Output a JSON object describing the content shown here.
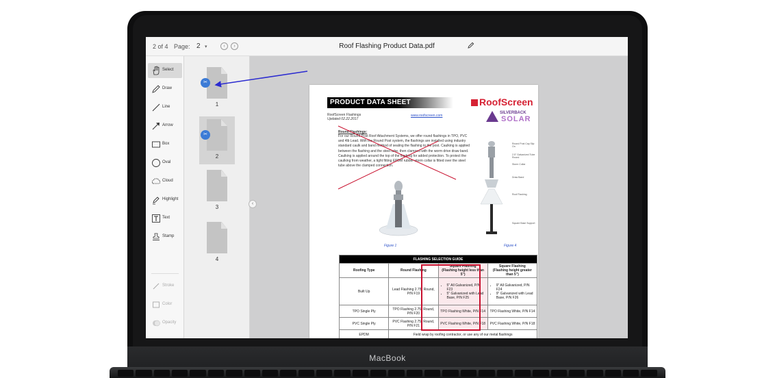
{
  "laptop": {
    "brand": "MacBook"
  },
  "topbar": {
    "page_count": "2 of 4",
    "page_label": "Page:",
    "page_value": "2",
    "caret": "▾",
    "prev": "‹",
    "next": "›",
    "title": "Roof Flashing Product Data.pdf"
  },
  "tools": [
    {
      "label": "Select",
      "icon": "hand-icon"
    },
    {
      "label": "Draw",
      "icon": "pencil-icon"
    },
    {
      "label": "Line",
      "icon": "line-icon"
    },
    {
      "label": "Arrow",
      "icon": "arrow-icon"
    },
    {
      "label": "Box",
      "icon": "box-icon"
    },
    {
      "label": "Oval",
      "icon": "oval-icon"
    },
    {
      "label": "Cloud",
      "icon": "cloud-icon"
    },
    {
      "label": "Highlight",
      "icon": "highlighter-icon"
    },
    {
      "label": "Text",
      "icon": "text-icon"
    },
    {
      "label": "Stamp",
      "icon": "stamp-icon"
    },
    {
      "label": "Stroke",
      "icon": "stroke-icon"
    },
    {
      "label": "Color",
      "icon": "color-icon"
    },
    {
      "label": "Opacity",
      "icon": "opacity-icon"
    }
  ],
  "thumbnails": [
    {
      "num": "1",
      "badge": "✂",
      "selected": false
    },
    {
      "num": "2",
      "badge": "✂",
      "selected": true
    },
    {
      "num": "3",
      "selected": false
    },
    {
      "num": "4",
      "selected": false
    }
  ],
  "collapse_glyph": "‹",
  "document": {
    "header": "PRODUCT DATA SHEET",
    "logo": "RoofScreen",
    "solar_top": "SILVERBACK",
    "solar_bottom": "SOLAR",
    "subtitle": "RoofScreen Flashings",
    "updated": "Updated 02.22.2017",
    "link": "www.roofscreen.com",
    "section_title": "Round Flashings:",
    "body": "For our Round Post Roof Attachment Systems, we offer round flashings in TPO, PVC and 4lb Lead. With the Round Post system, the flashings are installed using industry standard caulk and band method of sealing the flashing to the post. Caulking is applied between the flashing and the steel tube, then clamped with the worm drive draw band. Caulking is applied around the top of the flashing for added protection. To protect the caulking from weather, a tight fitting EPDM rubber storm collar is fitted over the steel tube above the clamped connection.",
    "fig1": "Figure 1",
    "fig4": "Figure 4",
    "callouts": [
      "Round Post Cap Slip On",
      "2.5\" Galvanized Tube Round",
      "Storm Collar",
      "Draw Band",
      "Roof Flashing",
      "Square Base Support"
    ],
    "table": {
      "caption": "FLASHING SELECTION GUIDE",
      "headers": [
        "Roofing Type",
        "Round Flashing",
        "Square Flashing\n(Flashing height less than 5\")",
        "Square Flashing\n(Flashing height greater than 5\")"
      ],
      "rows": [
        {
          "type": "Built Up",
          "round": "Lead Flashing 2.75\" Round, P/N F19",
          "sq_lt": [
            "5\" All Galvanized, P/N F23",
            "5\" Galvanized with Lead Base, P/N F25"
          ],
          "sq_gt": [
            "9\" All Galvanized, P/N F24",
            "9\" Galvanized with Lead Base, P/N F26"
          ]
        },
        {
          "type": "TPO Single Ply",
          "round": "TPO Flashing 2.75\" Round, P/N F20",
          "sq_lt": "TPO Flashing White, P/N F14",
          "sq_gt": "TPO Flashing White, P/N F14"
        },
        {
          "type": "PVC Single Ply",
          "round": "PVC Flashing 2.75\" Round, P/N F21",
          "sq_lt": "PVC Flashing White, P/N F18",
          "sq_gt": "PVC Flashing White, P/N F18"
        },
        {
          "type": "EPDM",
          "note": "Field wrap by roofing contractor, or use any of our metal flashings"
        }
      ]
    }
  },
  "colors": {
    "accent": "#3c7bd6",
    "arrow": "#2b2bd0",
    "highlight_box": "#c8102e",
    "strike": "#c8102e"
  }
}
